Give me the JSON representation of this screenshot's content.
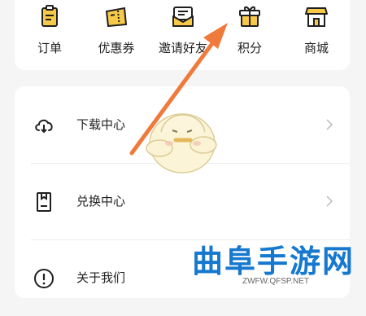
{
  "quick_actions": [
    {
      "label": "订单",
      "icon": "clipboard-icon"
    },
    {
      "label": "优惠券",
      "icon": "ticket-icon"
    },
    {
      "label": "邀请好友",
      "icon": "envelope-icon"
    },
    {
      "label": "积分",
      "icon": "gift-icon"
    },
    {
      "label": "商城",
      "icon": "store-icon"
    }
  ],
  "menu": [
    {
      "label": "下载中心",
      "icon": "cloud-download-icon"
    },
    {
      "label": "兑换中心",
      "icon": "redeem-icon"
    },
    {
      "label": "关于我们",
      "icon": "info-icon"
    }
  ],
  "watermark": {
    "logo": "曲阜手游网",
    "url": "ZWFW.QFSP.NET"
  },
  "colors": {
    "icon_stroke": "#1f1f1f",
    "icon_fill": "#f7c948",
    "arrow": "#f07a3c",
    "watermark": "#1678cf"
  }
}
